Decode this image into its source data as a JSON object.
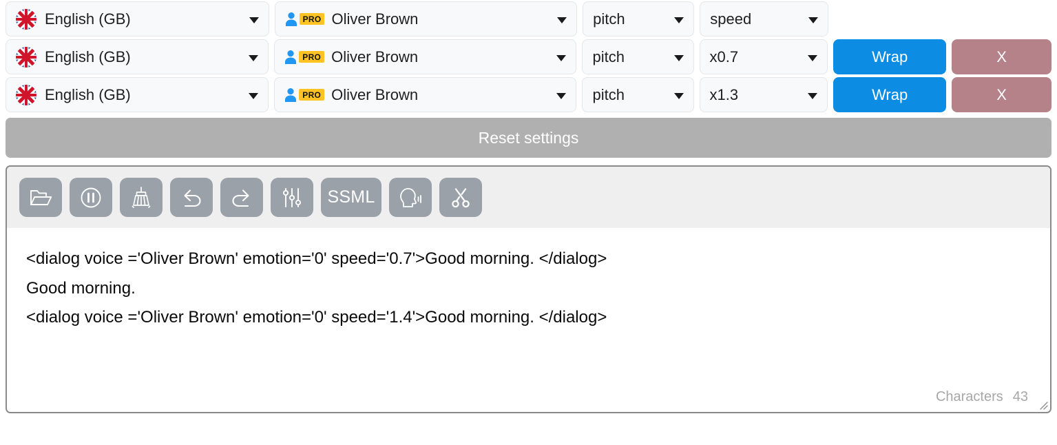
{
  "rows": [
    {
      "language": "English (GB)",
      "language_icon": "uk-flag-icon",
      "voice": "Oliver Brown",
      "voice_badge": "PRO",
      "voice_icon": "person-icon",
      "pitch": "pitch",
      "speed": "speed",
      "wrap_label": "",
      "delete_label": "",
      "has_actions": false
    },
    {
      "language": "English (GB)",
      "language_icon": "uk-flag-icon",
      "voice": "Oliver Brown",
      "voice_badge": "PRO",
      "voice_icon": "person-icon",
      "pitch": "pitch",
      "speed": "x0.7",
      "wrap_label": "Wrap",
      "delete_label": "X",
      "has_actions": true
    },
    {
      "language": "English (GB)",
      "language_icon": "uk-flag-icon",
      "voice": "Oliver Brown",
      "voice_badge": "PRO",
      "voice_icon": "person-icon",
      "pitch": "pitch",
      "speed": "x1.3",
      "wrap_label": "Wrap",
      "delete_label": "X",
      "has_actions": true
    }
  ],
  "reset": {
    "label": "Reset settings"
  },
  "toolbar": {
    "buttons": [
      {
        "name": "open-folder-icon",
        "label": ""
      },
      {
        "name": "pause-icon",
        "label": ""
      },
      {
        "name": "broom-clean-icon",
        "label": ""
      },
      {
        "name": "undo-icon",
        "label": ""
      },
      {
        "name": "redo-icon",
        "label": ""
      },
      {
        "name": "sliders-icon",
        "label": ""
      },
      {
        "name": "ssml-button",
        "label": "SSML"
      },
      {
        "name": "speaking-head-icon",
        "label": ""
      },
      {
        "name": "scissors-icon",
        "label": ""
      }
    ]
  },
  "editor": {
    "content": "<dialog voice ='Oliver Brown' emotion='0' speed='0.7'>Good morning. </dialog>\nGood morning.\n<dialog voice ='Oliver Brown' emotion='0' speed='1.4'>Good morning. </dialog>",
    "characters_label": "Characters",
    "characters_count": "43"
  },
  "colors": {
    "accent_blue": "#0d8ce3",
    "delete_red": "#b5828a",
    "reset_gray": "#b0b0b0",
    "pro_yellow": "#ffc423",
    "toolbar_button": "#9aa1a9"
  }
}
